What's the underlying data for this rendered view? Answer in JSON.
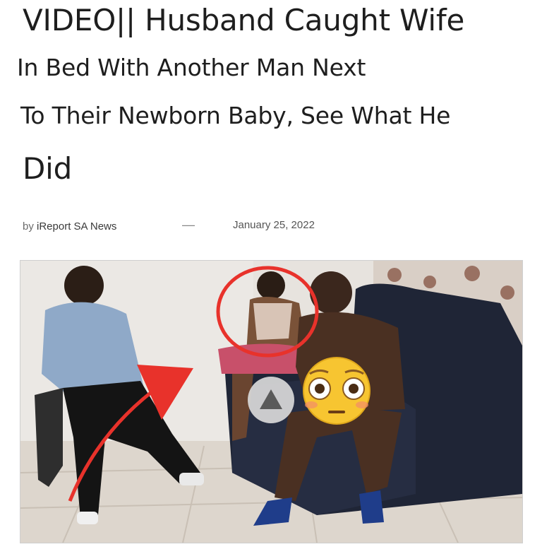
{
  "article": {
    "headline_lines": [
      "VIDEO|| Husband Caught Wife",
      "In Bed With Another Man Next",
      "To Their Newborn Baby, See What He",
      "Did"
    ],
    "byline_prefix": "by",
    "author": "iReport SA News",
    "separator": "—",
    "date": "January 25, 2022"
  },
  "media": {
    "type": "video-thumbnail",
    "play_icon": "play-triangle-icon",
    "emoji": "flushed-face-emoji",
    "annotations": [
      "red-circle-annotation",
      "red-arrow-annotation"
    ],
    "colors": {
      "annotation_red": "#e8322b",
      "play_button_bg": "#d9d9d9",
      "play_button_icon": "#5a5a5a",
      "emoji_yellow": "#f7c531"
    }
  }
}
